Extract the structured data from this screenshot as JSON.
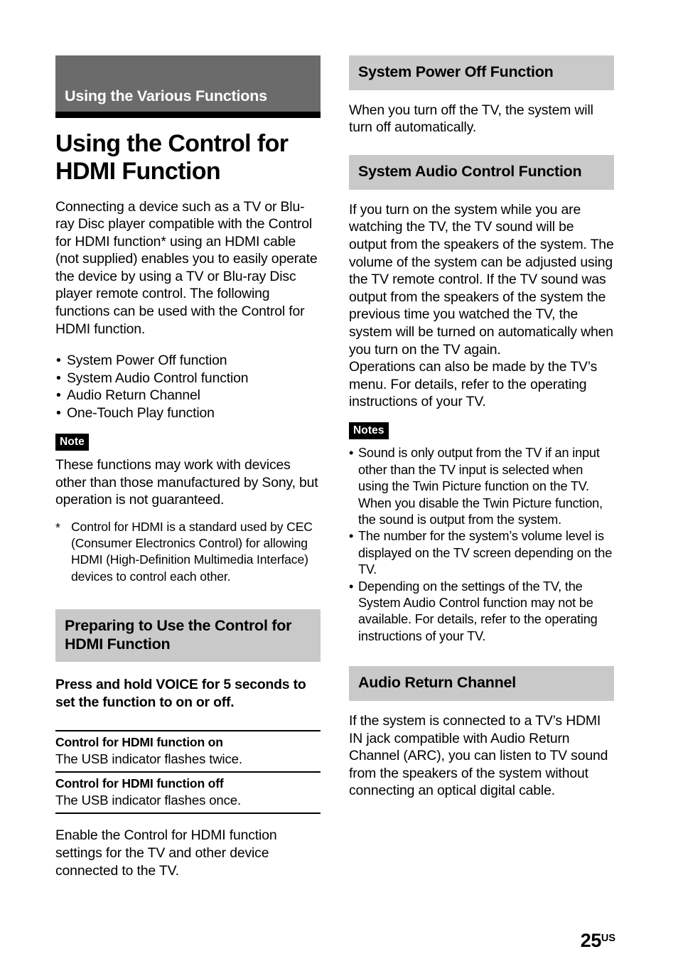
{
  "chapter": {
    "banner_title": "Using the Various Functions"
  },
  "page_title": "Using the Control for HDMI Function",
  "left": {
    "intro_paragraph": "Connecting a device such as a TV or Blu-ray Disc player compatible with the Control for HDMI function* using an HDMI cable (not supplied) enables you to easily operate the device by using a TV or Blu-ray Disc player remote control. The following functions can be used with the Control for HDMI function.",
    "feature_bullets": [
      "System Power Off function",
      "System Audio Control function",
      "Audio Return Channel",
      "One-Touch Play function"
    ],
    "note_badge": "Note",
    "note_text": "These functions may work with devices other than those manufactured by Sony, but operation is not guaranteed.",
    "footnote_marker": "*",
    "footnote_text": "Control for HDMI is a standard used by CEC (Consumer Electronics Control) for allowing HDMI (High-Definition Multimedia Interface) devices to control each other.",
    "prepare_heading": "Preparing to Use the Control for HDMI Function",
    "prepare_instruction": "Press and hold VOICE for 5 seconds to set the function to on or off.",
    "table_rows": [
      {
        "term": "Control for HDMI function on",
        "desc": "The USB indicator flashes twice."
      },
      {
        "term": "Control for HDMI function off",
        "desc": "The USB indicator flashes once."
      }
    ],
    "closing_paragraph": "Enable the Control for HDMI function settings for the TV and other device connected to the TV."
  },
  "right": {
    "power_off_heading": "System Power Off Function",
    "power_off_text": "When you turn off the TV, the system will turn off automatically.",
    "audio_control_heading": "System Audio Control Function",
    "audio_control_text": "If you turn on the system while you are watching the TV, the TV sound will be output from the speakers of the system. The volume of the system can be adjusted using the TV remote control. If the TV sound was output from the speakers of the system the previous time you watched the TV, the system will be turned on automatically when you turn on the TV again.\nOperations can also be made by the TV’s menu. For details, refer to the operating instructions of your TV.",
    "notes_badge": "Notes",
    "notes_bullets": [
      "Sound is only output from the TV if an input other than the TV input is selected when using the Twin Picture function on the TV. When you disable the Twin Picture function, the sound is output from the system.",
      "The number for the system’s volume level is displayed on the TV screen depending on the TV.",
      "Depending on the settings of the TV, the System Audio Control function may not be available. For details, refer to the operating instructions of your TV."
    ],
    "arc_heading": "Audio Return Channel",
    "arc_text": "If the system is connected to a TV’s HDMI IN jack compatible with Audio Return Channel (ARC), you can listen to TV sound from the speakers of the system without connecting an optical digital cable."
  },
  "footer": {
    "page_number": "25",
    "page_suffix": "US"
  },
  "colors": {
    "banner_gray": "#6b6b6b",
    "heading_gray": "#c9c9c9",
    "badge_black": "#000000",
    "text_black": "#000000",
    "page_background": "#ffffff"
  }
}
